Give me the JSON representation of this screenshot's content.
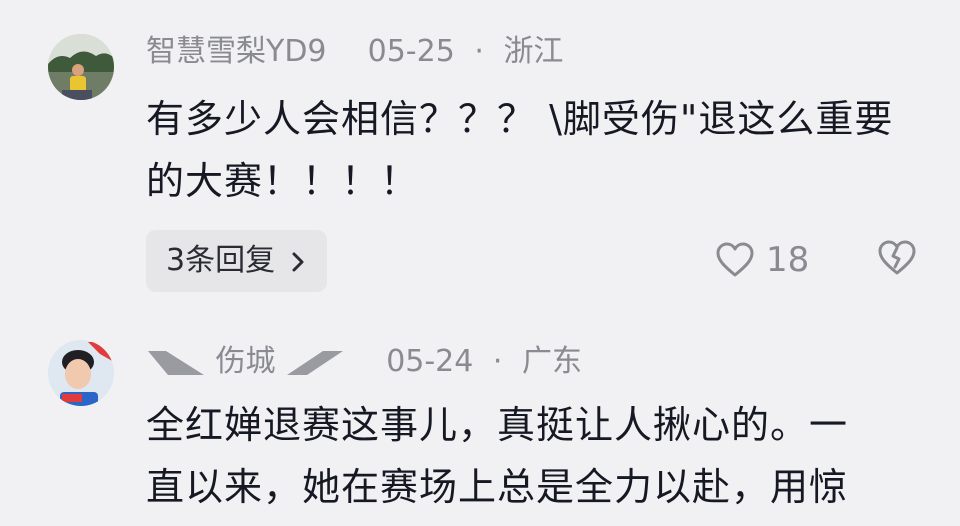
{
  "comments": [
    {
      "username": "智慧雪梨YD9",
      "date": "05-25",
      "separator": "·",
      "location": "浙江",
      "text_line1": "有多少人会相信？？？ \\脚受伤\"退这么重要",
      "text_line2": "的大赛！！！！",
      "reply_label": "3条回复",
      "like_count": "18",
      "icons": [
        "heart-outline-icon",
        "broken-heart-icon",
        "chevron-right-icon"
      ]
    },
    {
      "username": "伤城",
      "date": "05-24",
      "separator": "·",
      "location": "广东",
      "text_line1": "全红婵退赛这事儿，真挺让人揪心的。一",
      "text_line2": "直以来，她在赛场上总是全力以赴，用惊"
    }
  ],
  "colors": {
    "background": "#f1f1f3",
    "text_primary": "#161823",
    "text_secondary": "#8a8b91",
    "pill_bg": "#e6e6e8"
  }
}
